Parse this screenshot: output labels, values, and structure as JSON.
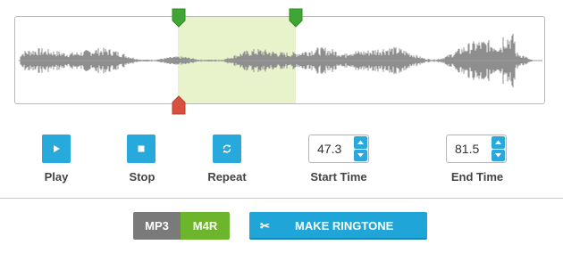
{
  "controls": {
    "play_label": "Play",
    "stop_label": "Stop",
    "repeat_label": "Repeat",
    "start_label": "Start Time",
    "end_label": "End Time"
  },
  "start_time": {
    "value": "47.3"
  },
  "end_time": {
    "value": "81.5"
  },
  "format": {
    "options": [
      "MP3",
      "M4R"
    ],
    "selected": "M4R"
  },
  "make_ringtone_label": "MAKE RINGTONE",
  "colors": {
    "accent": "#27a9dc",
    "selection": "#e8f0c8",
    "handle_green": "#3fa535",
    "handle_red": "#d9503e",
    "mp3_bg": "#7a7a7a",
    "m4r_bg": "#6cb52d"
  },
  "icons": {
    "play": "play-icon",
    "stop": "stop-icon",
    "repeat": "repeat-icon",
    "scissors": "scissors-icon"
  }
}
